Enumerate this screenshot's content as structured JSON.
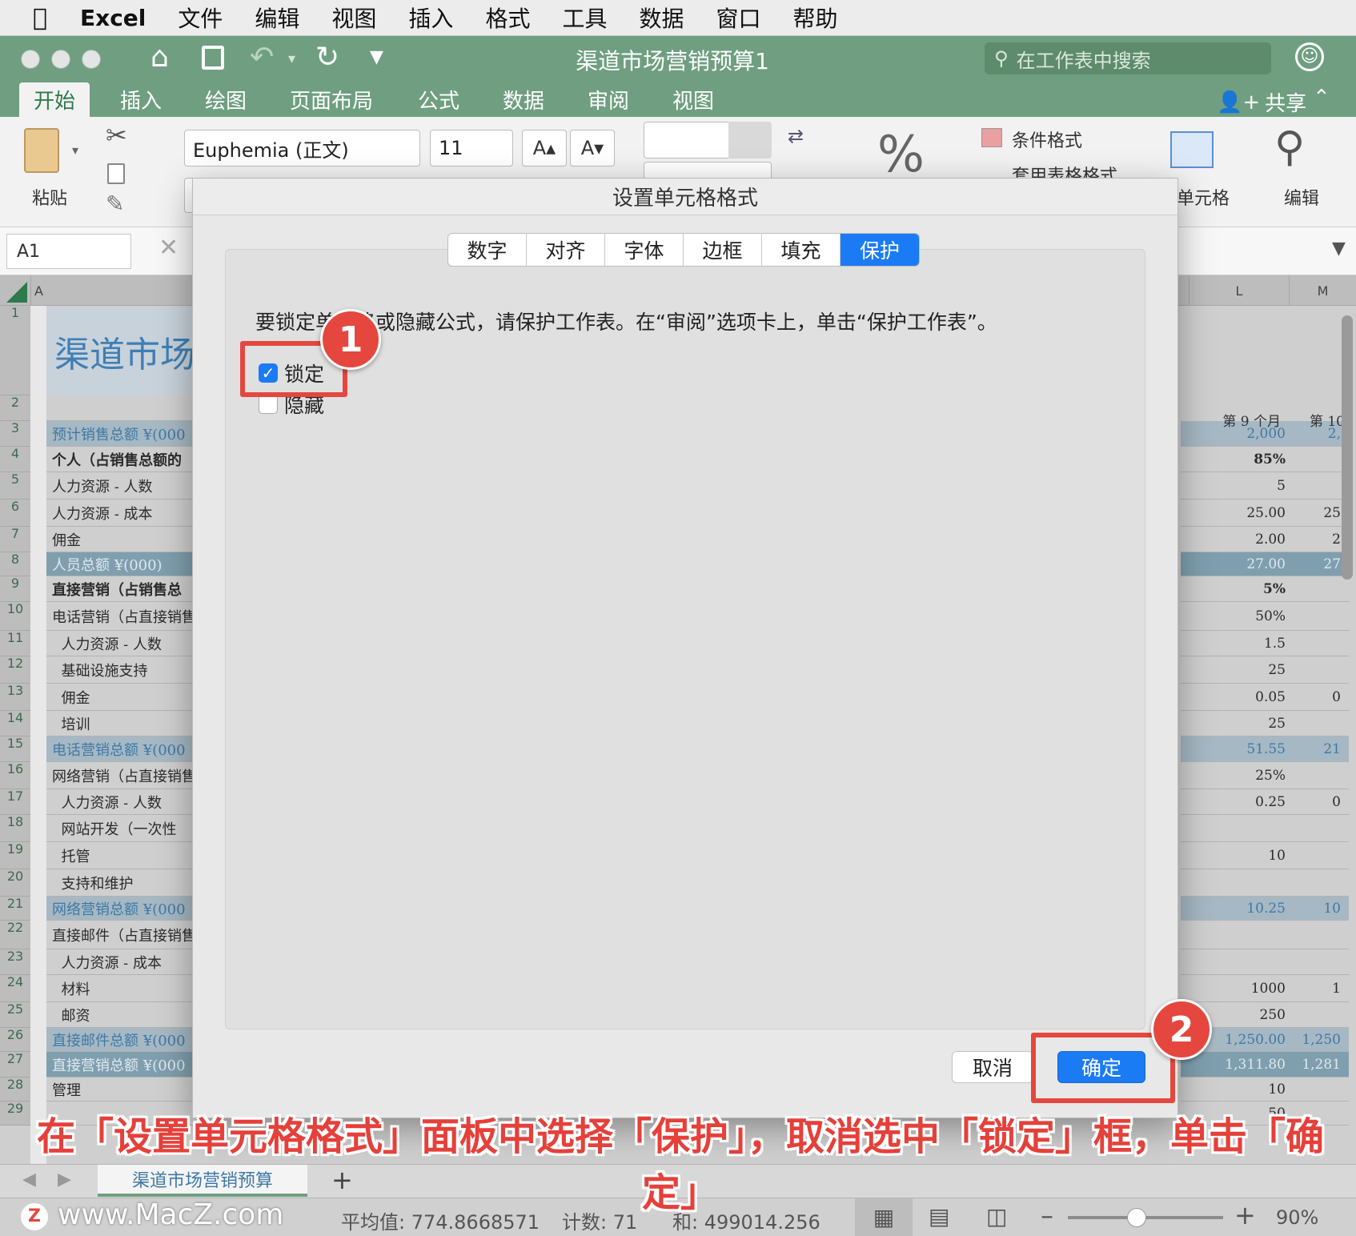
{
  "menubar": {
    "app": "Excel",
    "items": [
      "文件",
      "编辑",
      "视图",
      "插入",
      "格式",
      "工具",
      "数据",
      "窗口",
      "帮助"
    ]
  },
  "titlebar": {
    "title": "渠道市场营销预算1",
    "search_placeholder": "在工作表中搜索"
  },
  "ribbon": {
    "tabs": [
      "开始",
      "插入",
      "绘图",
      "页面布局",
      "公式",
      "数据",
      "审阅",
      "视图"
    ],
    "active_tab": "开始",
    "share": "共享",
    "paste_label": "粘贴",
    "font_name": "Euphemia (正文)",
    "font_size": "11",
    "conditional_format": "条件格式",
    "table_format": "套用表格格式",
    "cells_label": "单元格",
    "edit_label": "编辑",
    "percent": "%"
  },
  "formula_bar": {
    "name_box": "A1"
  },
  "sheet": {
    "columns_left": [
      "A"
    ],
    "columns_right": [
      "L",
      "M"
    ],
    "title_cell": "渠道市场",
    "right_header": {
      "k": "第 9 个月",
      "l": "第 10"
    },
    "rows": [
      {
        "n": "1",
        "a": ""
      },
      {
        "n": "2",
        "a": ""
      },
      {
        "n": "3",
        "a": "预计销售总额 ¥(000",
        "k": "2,000",
        "l": "2,",
        "style": "hl"
      },
      {
        "n": "4",
        "a": "个人（占销售总额的",
        "k": "85%",
        "l": "",
        "style": "bold"
      },
      {
        "n": "5",
        "a": "人力资源 - 人数",
        "k": "5",
        "l": ""
      },
      {
        "n": "6",
        "a": "人力资源 - 成本",
        "k": "25.00",
        "l": "25"
      },
      {
        "n": "7",
        "a": "佣金",
        "k": "2.00",
        "l": "2"
      },
      {
        "n": "8",
        "a": "人员总额 ¥(000)",
        "k": "27.00",
        "l": "27",
        "style": "dk"
      },
      {
        "n": "9",
        "a": "直接营销（占销售总",
        "k": "5%",
        "l": "",
        "style": "bold"
      },
      {
        "n": "10",
        "a": "电话营销（占直接销售",
        "k": "50%",
        "l": ""
      },
      {
        "n": "11",
        "a": "  人力资源 - 人数",
        "k": "1.5",
        "l": ""
      },
      {
        "n": "12",
        "a": "  基础设施支持",
        "k": "25",
        "l": ""
      },
      {
        "n": "13",
        "a": "  佣金",
        "k": "0.05",
        "l": "0"
      },
      {
        "n": "14",
        "a": "  培训",
        "k": "25",
        "l": ""
      },
      {
        "n": "15",
        "a": "电话营销总额 ¥(000",
        "k": "51.55",
        "l": "21",
        "style": "hl"
      },
      {
        "n": "16",
        "a": "网络营销（占直接销售",
        "k": "25%",
        "l": ""
      },
      {
        "n": "17",
        "a": "  人力资源 - 人数",
        "k": "0.25",
        "l": "0"
      },
      {
        "n": "18",
        "a": "  网站开发（一次性",
        "k": "",
        "l": ""
      },
      {
        "n": "19",
        "a": "  托管",
        "k": "10",
        "l": ""
      },
      {
        "n": "20",
        "a": "  支持和维护",
        "k": "",
        "l": ""
      },
      {
        "n": "21",
        "a": "网络营销总额 ¥(000",
        "k": "10.25",
        "l": "10",
        "style": "hl"
      },
      {
        "n": "22",
        "a": "直接邮件（占直接销售",
        "k": "",
        "l": ""
      },
      {
        "n": "23",
        "a": "  人力资源 - 成本",
        "k": "",
        "l": ""
      },
      {
        "n": "24",
        "a": "  材料",
        "k": "1000",
        "l": "1"
      },
      {
        "n": "25",
        "a": "  邮资",
        "k": "250",
        "l": ""
      },
      {
        "n": "26",
        "a": "直接邮件总额 ¥(000",
        "k": "1,250.00",
        "l": "1,250",
        "style": "hl"
      },
      {
        "n": "27",
        "a": "直接营销总额 ¥(000",
        "k": "1,311.80",
        "l": "1,281",
        "style": "dk"
      },
      {
        "n": "28",
        "a": "管理",
        "k": "10",
        "l": ""
      },
      {
        "n": "29",
        "a": "",
        "k": "50",
        "l": ""
      }
    ]
  },
  "sheet_tab": "渠道市场营销预算",
  "status": {
    "average": "平均值: 774.8668571",
    "count": "计数: 71",
    "sum": "和: 499014.256",
    "zoom": "90%",
    "watermark": "www.MacZ.com"
  },
  "dialog": {
    "title": "设置单元格格式",
    "tabs": [
      "数字",
      "对齐",
      "字体",
      "边框",
      "填充",
      "保护"
    ],
    "selected_tab": "保护",
    "note": "要锁定单元格或隐藏公式，请保护工作表。在“审阅”选项卡上，单击“保护工作表”。",
    "checkbox_locked": {
      "label": "锁定",
      "checked": true
    },
    "checkbox_hidden": {
      "label": "隐藏",
      "checked": false
    },
    "cancel": "取消",
    "ok": "确定"
  },
  "annotations": {
    "step1": "1",
    "step2": "2",
    "caption": "在「设置单元格格式」面板中选择「保护」，取消选中「锁定」框，单击「确定」"
  },
  "colors": {
    "accent": "#1b7bf5",
    "excel_green": "#6f9f80",
    "annotation_red": "#e5473e"
  }
}
